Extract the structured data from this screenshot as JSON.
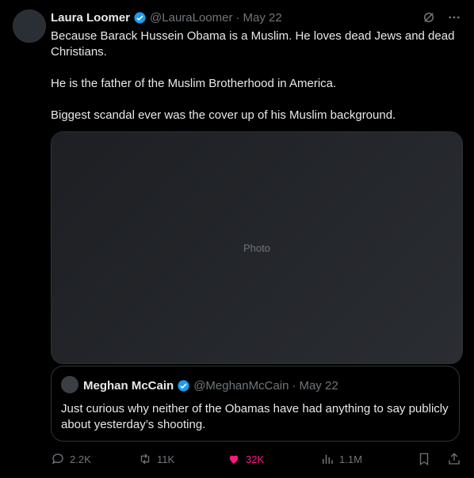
{
  "tweet": {
    "author_name": "Laura Loomer",
    "handle": "@LauraLoomer",
    "separator": "·",
    "date": "May 22",
    "body": [
      "Because Barack Hussein Obama is a Muslim. He loves dead Jews and dead Christians.",
      "He is the father of the Muslim Brotherhood in America.",
      "Biggest scandal ever was the cover up of his Muslim background."
    ],
    "media_placeholder": "Photo"
  },
  "quote": {
    "author_name": "Meghan McCain",
    "handle": "@MeghanMcCain",
    "separator": "·",
    "date": "May 22",
    "text": "Just curious why neither of the Obamas have had anything to say publicly about yesterday’s shooting."
  },
  "actions": {
    "replies": "2.2K",
    "retweets": "11K",
    "likes": "32K",
    "views": "1.1M"
  },
  "colors": {
    "background": "#000000",
    "text": "#e7e9ea",
    "muted": "#71767b",
    "border": "#2f3336",
    "verified": "#1d9bf0",
    "like": "#f91880"
  },
  "icons": [
    "verified-badge-icon",
    "grok-icon",
    "more-icon",
    "reply-icon",
    "retweet-icon",
    "like-icon",
    "views-icon",
    "bookmark-icon",
    "share-icon"
  ]
}
